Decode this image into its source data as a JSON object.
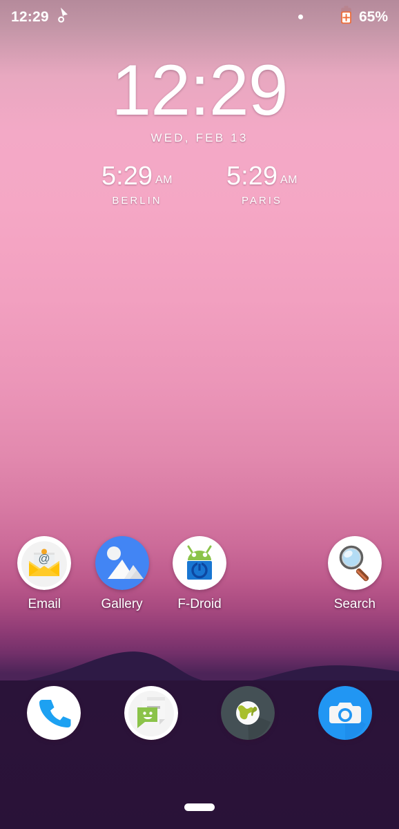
{
  "status_bar": {
    "clock": "12:29",
    "battery_percent": "65%",
    "notification_icon": "pointer-cursor-icon",
    "status_dot_icon": "dot-indicator-icon",
    "battery_icon": "battery-charging-icon",
    "battery_icon_color": "#ef6c37",
    "text_color": "#ffffff"
  },
  "clock_widget": {
    "time": "12:29",
    "date": "WED, FEB 13",
    "cities": [
      {
        "time": "5:29",
        "ampm": "AM",
        "name": "BERLIN"
      },
      {
        "time": "5:29",
        "ampm": "AM",
        "name": "PARIS"
      }
    ]
  },
  "app_grid": {
    "apps": [
      {
        "label": "Email",
        "icon": "email-envelope-icon",
        "present": true
      },
      {
        "label": "Gallery",
        "icon": "gallery-photo-icon",
        "present": true
      },
      {
        "label": "F-Droid",
        "icon": "fdroid-android-icon",
        "present": true
      },
      {
        "label": "",
        "icon": "",
        "present": false
      },
      {
        "label": "Search",
        "icon": "search-magnifier-icon",
        "present": true
      }
    ]
  },
  "dock": {
    "apps": [
      {
        "label": "Phone",
        "icon": "phone-handset-icon"
      },
      {
        "label": "Messaging",
        "icon": "messaging-bubble-icon"
      },
      {
        "label": "Browser",
        "icon": "browser-globe-icon"
      },
      {
        "label": "Camera",
        "icon": "camera-icon"
      }
    ]
  },
  "nav_bar": {
    "gesture_pill": "home-gesture-pill"
  },
  "theme": {
    "wallpaper_top": "#b58a9b",
    "wallpaper_mid": "#f3a9c6",
    "wallpaper_lower": "#a84a80",
    "mountain": "#2e1a45",
    "ground": "#2a1339",
    "icon_circle": "#ffffff"
  }
}
